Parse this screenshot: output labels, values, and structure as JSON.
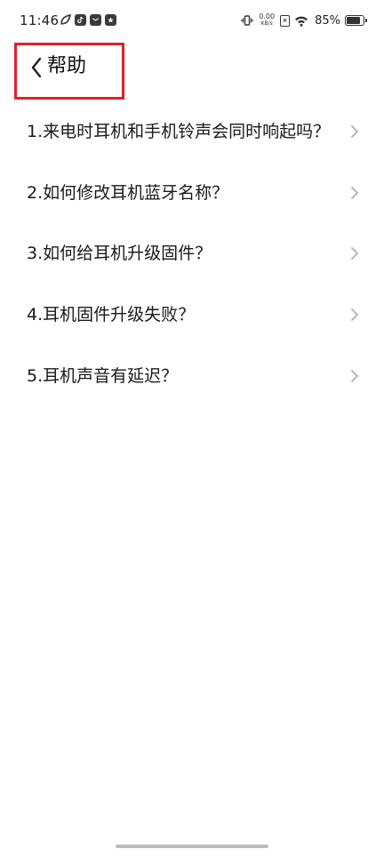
{
  "status_bar": {
    "time": "11:46",
    "notification_icons": [
      "leaf-icon",
      "tiktok-icon",
      "mail-icon",
      "star-message-icon"
    ],
    "net_speed_value": "0.00",
    "net_speed_unit": "KB/s",
    "sim_label": "×",
    "battery_percent": "85%",
    "battery_level": 0.85
  },
  "header": {
    "title": "帮助"
  },
  "faq": [
    {
      "label": "1.来电时耳机和手机铃声会同时响起吗？"
    },
    {
      "label": "2.如何修改耳机蓝牙名称？"
    },
    {
      "label": "3.如何给耳机升级固件？"
    },
    {
      "label": "4.耳机固件升级失败？"
    },
    {
      "label": "5.耳机声音有延迟？"
    }
  ],
  "colors": {
    "highlight_box": "#e0202a",
    "chevron": "#b0b0b0",
    "text": "#1a1a1a"
  }
}
